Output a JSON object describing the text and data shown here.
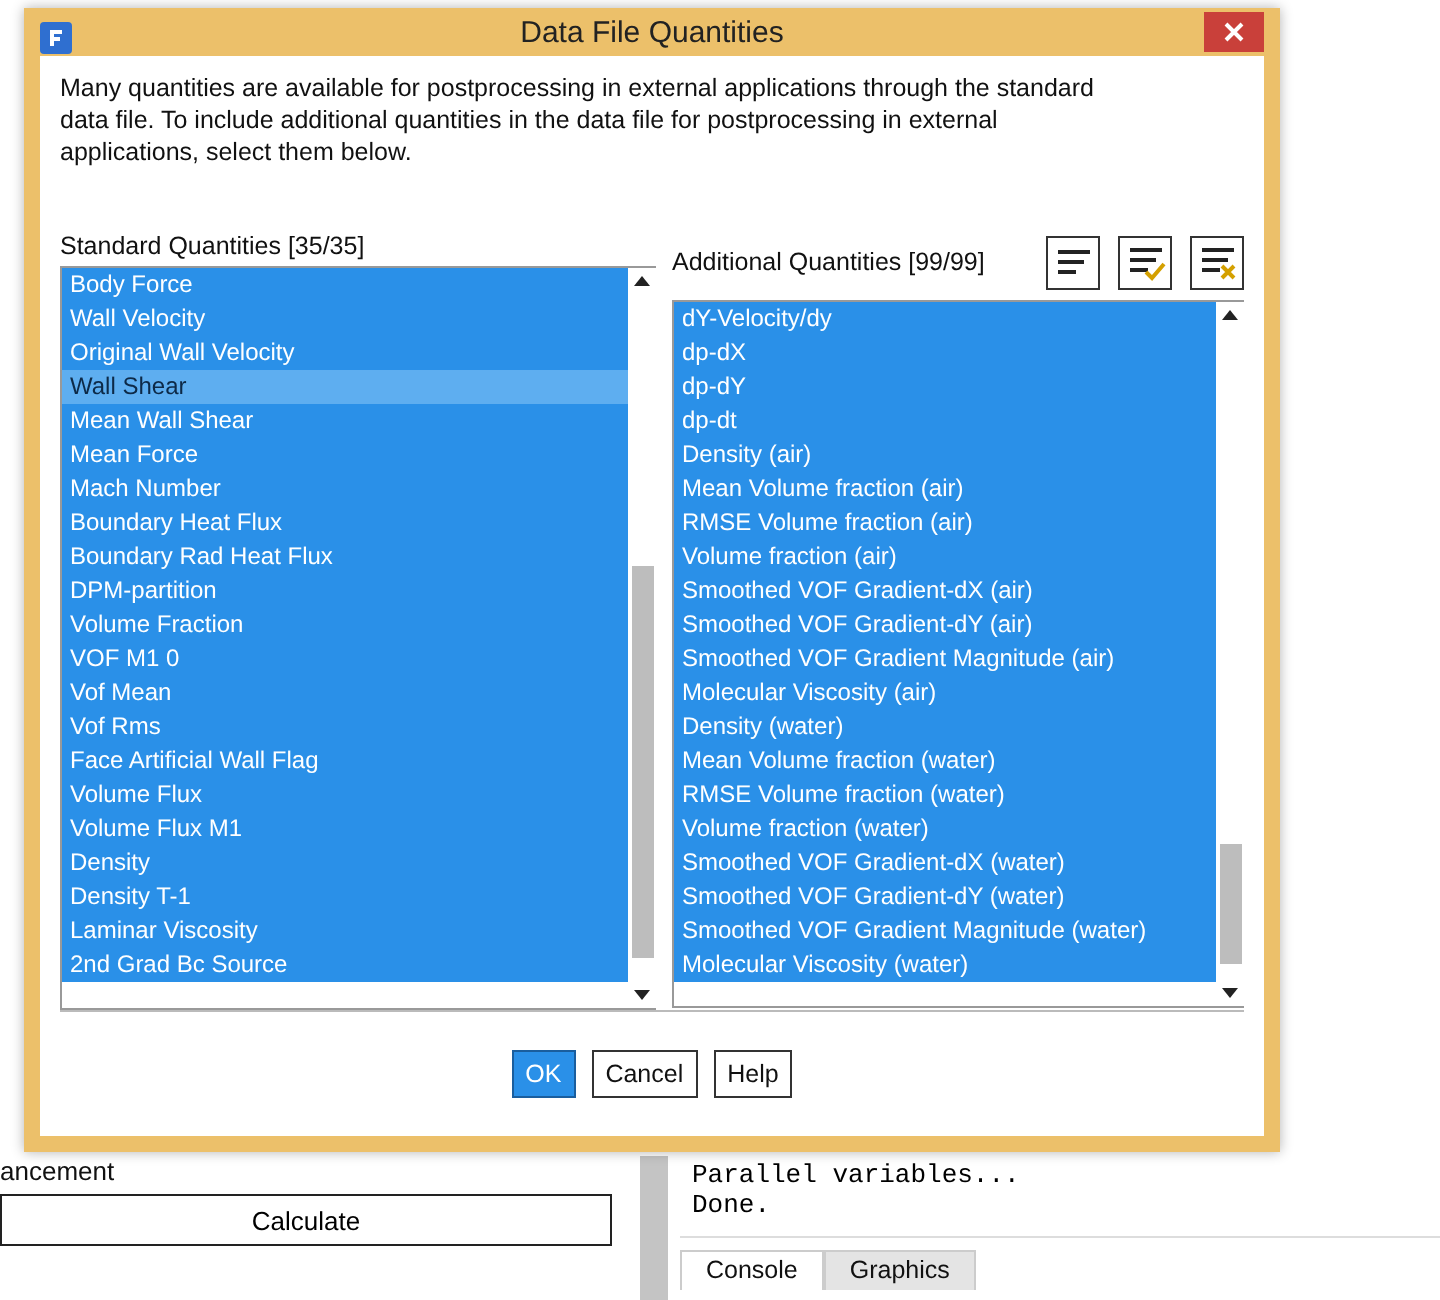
{
  "dialog": {
    "title": "Data File Quantities",
    "description": "Many quantities are available for postprocessing in external applications through the standard data file. To include additional quantities in the data file for postprocessing in external applications, select them below.",
    "standard": {
      "label": "Standard Quantities [35/35]",
      "items": [
        {
          "label": "Body Force",
          "selected": true,
          "highlighted": false
        },
        {
          "label": "Wall Velocity",
          "selected": true,
          "highlighted": false
        },
        {
          "label": "Original Wall Velocity",
          "selected": true,
          "highlighted": false
        },
        {
          "label": "Wall Shear",
          "selected": true,
          "highlighted": true
        },
        {
          "label": "Mean Wall Shear",
          "selected": true,
          "highlighted": false
        },
        {
          "label": "Mean Force",
          "selected": true,
          "highlighted": false
        },
        {
          "label": "Mach Number",
          "selected": true,
          "highlighted": false
        },
        {
          "label": "Boundary Heat Flux",
          "selected": true,
          "highlighted": false
        },
        {
          "label": "Boundary Rad Heat Flux",
          "selected": true,
          "highlighted": false
        },
        {
          "label": "DPM-partition",
          "selected": true,
          "highlighted": false
        },
        {
          "label": "Volume Fraction",
          "selected": true,
          "highlighted": false
        },
        {
          "label": "VOF M1 0",
          "selected": true,
          "highlighted": false
        },
        {
          "label": "Vof Mean",
          "selected": true,
          "highlighted": false
        },
        {
          "label": "Vof Rms",
          "selected": true,
          "highlighted": false
        },
        {
          "label": "Face Artificial Wall Flag",
          "selected": true,
          "highlighted": false
        },
        {
          "label": "Volume Flux",
          "selected": true,
          "highlighted": false
        },
        {
          "label": "Volume Flux M1",
          "selected": true,
          "highlighted": false
        },
        {
          "label": "Density",
          "selected": true,
          "highlighted": false
        },
        {
          "label": "Density T-1",
          "selected": true,
          "highlighted": false
        },
        {
          "label": "Laminar Viscosity",
          "selected": true,
          "highlighted": false
        },
        {
          "label": "2nd Grad Bc Source",
          "selected": true,
          "highlighted": false
        }
      ]
    },
    "additional": {
      "label": "Additional Quantities [99/99]",
      "items": [
        {
          "label": "dY-Velocity/dy",
          "selected": true,
          "highlighted": false
        },
        {
          "label": "dp-dX",
          "selected": true,
          "highlighted": false
        },
        {
          "label": "dp-dY",
          "selected": true,
          "highlighted": false
        },
        {
          "label": "dp-dt",
          "selected": true,
          "highlighted": false
        },
        {
          "label": "Density (air)",
          "selected": true,
          "highlighted": false
        },
        {
          "label": "Mean Volume fraction (air)",
          "selected": true,
          "highlighted": false
        },
        {
          "label": "RMSE Volume fraction (air)",
          "selected": true,
          "highlighted": false
        },
        {
          "label": "Volume fraction (air)",
          "selected": true,
          "highlighted": false
        },
        {
          "label": "Smoothed VOF Gradient-dX (air)",
          "selected": true,
          "highlighted": false
        },
        {
          "label": "Smoothed VOF Gradient-dY (air)",
          "selected": true,
          "highlighted": false
        },
        {
          "label": "Smoothed VOF Gradient Magnitude (air)",
          "selected": true,
          "highlighted": false
        },
        {
          "label": "Molecular Viscosity (air)",
          "selected": true,
          "highlighted": false
        },
        {
          "label": "Density (water)",
          "selected": true,
          "highlighted": false
        },
        {
          "label": "Mean Volume fraction (water)",
          "selected": true,
          "highlighted": false
        },
        {
          "label": "RMSE Volume fraction (water)",
          "selected": true,
          "highlighted": false
        },
        {
          "label": "Volume fraction (water)",
          "selected": true,
          "highlighted": false
        },
        {
          "label": "Smoothed VOF Gradient-dX (water)",
          "selected": true,
          "highlighted": false
        },
        {
          "label": "Smoothed VOF Gradient-dY (water)",
          "selected": true,
          "highlighted": false
        },
        {
          "label": "Smoothed VOF Gradient Magnitude (water)",
          "selected": true,
          "highlighted": false
        },
        {
          "label": "Molecular Viscosity (water)",
          "selected": true,
          "highlighted": false
        }
      ],
      "tools": [
        {
          "kind": "list"
        },
        {
          "kind": "select-all"
        },
        {
          "kind": "deselect-all"
        }
      ]
    },
    "buttons": [
      {
        "label": "OK",
        "default": true
      },
      {
        "label": "Cancel",
        "default": false
      },
      {
        "label": "Help",
        "default": false
      }
    ]
  },
  "background": {
    "section_label": "ancement",
    "calculate_button": "Calculate",
    "console_lines": [
      "Parallel variables...",
      "Done."
    ],
    "tabs": [
      {
        "label": "Console",
        "selected": true
      },
      {
        "label": "Graphics",
        "selected": false
      }
    ]
  }
}
